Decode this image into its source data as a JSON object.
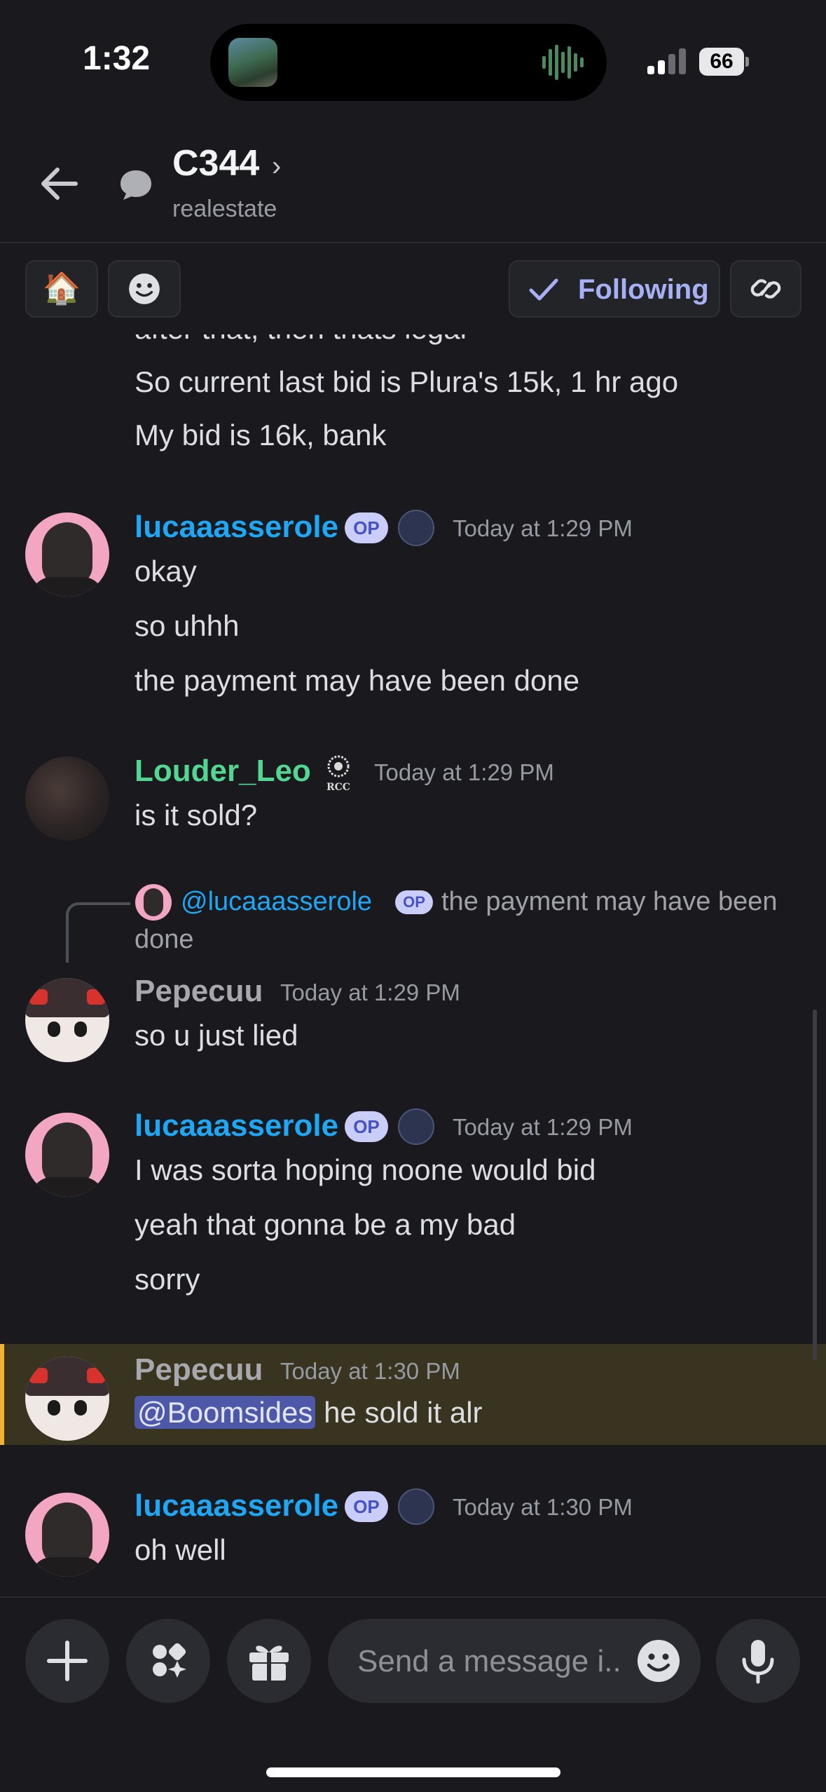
{
  "status_bar": {
    "time": "1:32",
    "battery": "66"
  },
  "header": {
    "title": "C344",
    "chevron": "›",
    "subtitle": "realestate"
  },
  "chips": {
    "house_emoji": "🏠",
    "following_label": "Following"
  },
  "messages": {
    "prev_cut": "after that, then thats legal",
    "prev_line1": "So current last bid is Plura's 15k, 1 hr ago",
    "prev_line2": "My bid is 16k, bank",
    "m1": {
      "author": "lucaaasserole",
      "op": "OP",
      "time": "Today at 1:29 PM",
      "lines": [
        "okay",
        "so uhhh",
        "the payment may have been done"
      ]
    },
    "m2": {
      "author": "Louder_Leo",
      "badge": "RCC",
      "time": "Today at 1:29 PM",
      "lines": [
        "is it sold?"
      ]
    },
    "m3": {
      "reply_name": "@lucaaasserole",
      "reply_op": "OP",
      "reply_text1": "the payment may have been",
      "reply_text2": "done",
      "author": "Pepecuu",
      "time": "Today at 1:29 PM",
      "lines": [
        "so u just lied"
      ]
    },
    "m4": {
      "author": "lucaaasserole",
      "op": "OP",
      "time": "Today at 1:29 PM",
      "lines": [
        "I was sorta hoping noone would bid",
        "yeah that gonna be a my bad",
        "sorry"
      ]
    },
    "m5": {
      "author": "Pepecuu",
      "time": "Today at 1:30 PM",
      "mention": "@Boomsides",
      "text": " he sold it alr"
    },
    "m6": {
      "author": "lucaaasserole",
      "op": "OP",
      "time": "Today at 1:30 PM",
      "lines": [
        "oh well"
      ]
    }
  },
  "composer": {
    "placeholder": "Send a message i.."
  },
  "icons": [
    "back-arrow-icon",
    "thread-icon",
    "smiley-icon",
    "check-icon",
    "link-icon",
    "plus-icon",
    "apps-icon",
    "gift-icon",
    "emoji-icon",
    "mic-icon"
  ],
  "colors": {
    "background": "#1a1a1e",
    "op_author": "#1ea7f5",
    "leo_author": "#52d692",
    "mention_bg": "#38341f",
    "accent": "#f0b232"
  }
}
